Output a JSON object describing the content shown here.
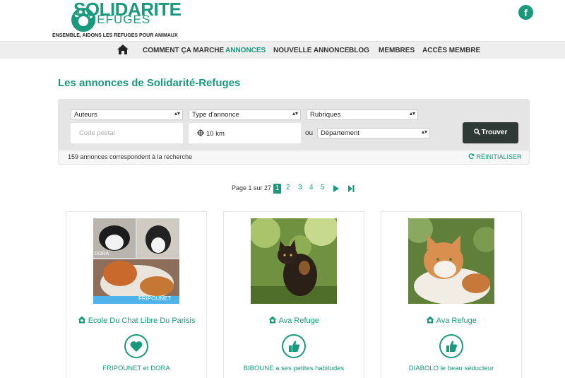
{
  "brand": {
    "word1": "SOLIDARITE",
    "word2": "REFUGES",
    "tagline": "ENSEMBLE, AIDONS LES REFUGES POUR ANIMAUX",
    "color": "#1a9a7d"
  },
  "social": {
    "facebook_glyph": "f",
    "icon": "facebook-icon"
  },
  "nav": {
    "home_icon": "home-icon",
    "items": [
      {
        "label": "COMMENT ÇA MARCHE"
      },
      {
        "label": "ANNONCES"
      },
      {
        "label": "NOUVELLE ANNONCE"
      },
      {
        "label": "BLOG"
      },
      {
        "label": "MEMBRES"
      },
      {
        "label": "ACCÈS MEMBRE"
      }
    ],
    "active": "ANNONCES"
  },
  "page": {
    "title": "Les annonces de Solidarité-Refuges"
  },
  "search": {
    "auteurs": "Auteurs",
    "type": "Type d'annonce",
    "rubriques": "Rubriques",
    "code_postal_placeholder": "Code postal",
    "distance": "10 km",
    "ou": "ou",
    "departement": "Département",
    "submit": "Trouver",
    "result_count": "159 annonces correspondent à la recherche",
    "reset": "RÉINITIALISER"
  },
  "pagination": {
    "label": "Page 1 sur 27",
    "pages": [
      "1",
      "2",
      "3",
      "4",
      "5"
    ],
    "current": "1"
  },
  "cards": [
    {
      "refuge": "Ecole Du Chat Libre Du Parisis",
      "name": "FRIPOUNET et DORA",
      "action_icon": "heart-icon",
      "photo_labels": [
        "DORA",
        "FRIPOUNET"
      ]
    },
    {
      "refuge": "Ava Refuge",
      "name": "BIBOUNE a ses petites habitudes",
      "action_icon": "thumbs-up-icon"
    },
    {
      "refuge": "Ava Refuge",
      "name": "DIABOLO le beau séducteur",
      "action_icon": "thumbs-up-icon"
    }
  ]
}
